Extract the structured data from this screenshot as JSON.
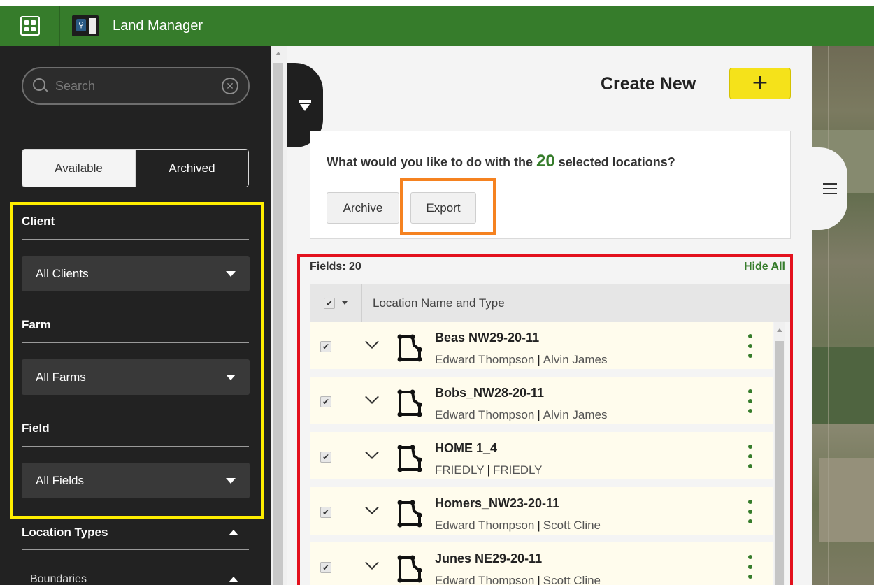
{
  "app": {
    "title": "Land Manager"
  },
  "sidebar": {
    "search_placeholder": "Search",
    "tabs": [
      {
        "label": "Available",
        "active": true
      },
      {
        "label": "Archived",
        "active": false
      }
    ],
    "filters": [
      {
        "label": "Client",
        "value": "All Clients"
      },
      {
        "label": "Farm",
        "value": "All Farms"
      },
      {
        "label": "Field",
        "value": "All Fields"
      }
    ],
    "location_types_label": "Location Types",
    "boundaries_label": "Boundaries"
  },
  "main": {
    "create_new_label": "Create New",
    "create_button": "+",
    "question_prefix": "What would you like to do with the",
    "selected_count": "20",
    "question_suffix": "selected locations?",
    "archive_button": "Archive",
    "export_button": "Export",
    "fields_count": "Fields: 20",
    "hide_all": "Hide All",
    "column_header": "Location Name and Type",
    "rows": [
      {
        "name": "Beas NW29-20-11",
        "client": "Edward Thompson",
        "farm": "Alvin James"
      },
      {
        "name": "Bobs_NW28-20-11",
        "client": "Edward Thompson",
        "farm": "Alvin James"
      },
      {
        "name": "HOME 1_4",
        "client": "FRIEDLY",
        "farm": "FRIEDLY"
      },
      {
        "name": "Homers_NW23-20-11",
        "client": "Edward Thompson",
        "farm": "Scott Cline"
      },
      {
        "name": "Junes NE29-20-11",
        "client": "Edward Thompson",
        "farm": "Scott Cline"
      }
    ]
  },
  "colors": {
    "brand_green": "#367c2b",
    "create_yellow": "#f5e21a",
    "highlight_yellow": "#ffee00",
    "highlight_orange": "#f58220",
    "highlight_red": "#e3111d"
  },
  "icons": {
    "apps": "apps-grid-icon",
    "search": "search-icon",
    "clear": "clear-icon",
    "filter": "funnel-icon",
    "list": "list-icon",
    "boundary": "boundary-icon",
    "expand": "chevron-down-icon",
    "more": "kebab-menu-icon"
  }
}
